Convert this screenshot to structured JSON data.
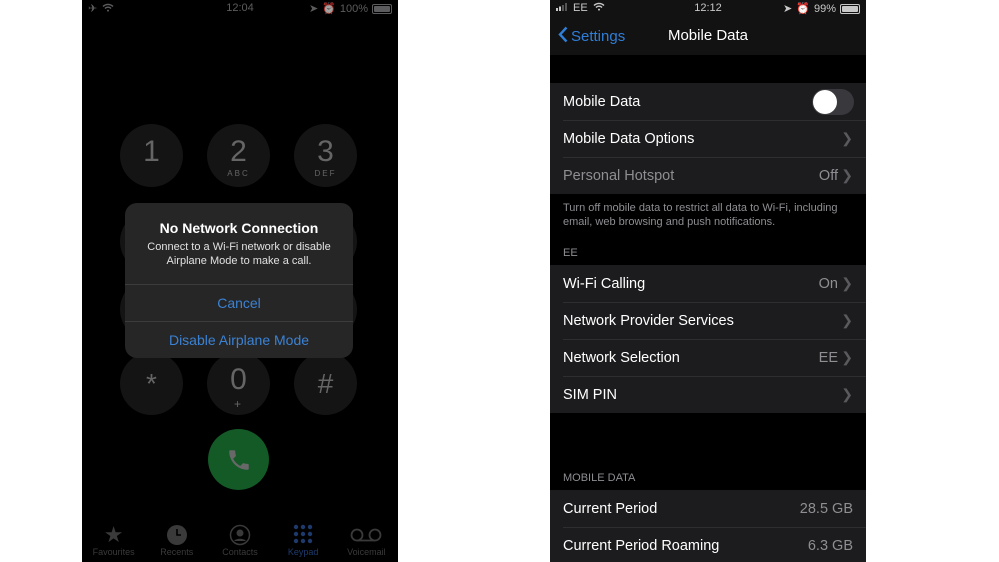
{
  "left_phone": {
    "status": {
      "time": "12:04",
      "battery": "100%",
      "battery_level": 1.0
    },
    "keypad": [
      {
        "digit": "1",
        "letters": ""
      },
      {
        "digit": "2",
        "letters": "ABC"
      },
      {
        "digit": "3",
        "letters": "DEF"
      },
      {
        "digit": "*",
        "letters": ""
      },
      {
        "digit": "0",
        "letters": "+"
      },
      {
        "digit": "#",
        "letters": ""
      }
    ],
    "alert": {
      "title": "No Network Connection",
      "message": "Connect to a Wi-Fi network or disable Airplane Mode to make a call.",
      "cancel": "Cancel",
      "disable": "Disable Airplane Mode"
    },
    "tabs": [
      {
        "label": "Favourites",
        "icon": "star-icon"
      },
      {
        "label": "Recents",
        "icon": "clock-icon"
      },
      {
        "label": "Contacts",
        "icon": "person-circle-icon"
      },
      {
        "label": "Keypad",
        "icon": "keypad-icon",
        "active": true
      },
      {
        "label": "Voicemail",
        "icon": "voicemail-icon"
      }
    ]
  },
  "right_phone": {
    "status": {
      "carrier": "EE",
      "time": "12:12",
      "battery": "99%",
      "battery_level": 0.99
    },
    "nav": {
      "back_label": "Settings",
      "title": "Mobile Data"
    },
    "group1": [
      {
        "label": "Mobile Data",
        "toggle": false
      },
      {
        "label": "Mobile Data Options",
        "value": ""
      },
      {
        "label": "Personal Hotspot",
        "value": "Off"
      }
    ],
    "group1_footer": "Turn off mobile data to restrict all data to Wi-Fi, including email, web browsing and push notifications.",
    "group2_header": "EE",
    "group2": [
      {
        "label": "Wi-Fi Calling",
        "value": "On"
      },
      {
        "label": "Network Provider Services",
        "value": ""
      },
      {
        "label": "Network Selection",
        "value": "EE"
      },
      {
        "label": "SIM PIN",
        "value": ""
      }
    ],
    "group3_header": "MOBILE DATA",
    "group3": [
      {
        "label": "Current Period",
        "value": "28.5 GB"
      },
      {
        "label": "Current Period Roaming",
        "value": "6.3 GB"
      }
    ],
    "colors": {
      "accent": "#2f7ed8",
      "call_green": "#1e8a3c"
    }
  }
}
